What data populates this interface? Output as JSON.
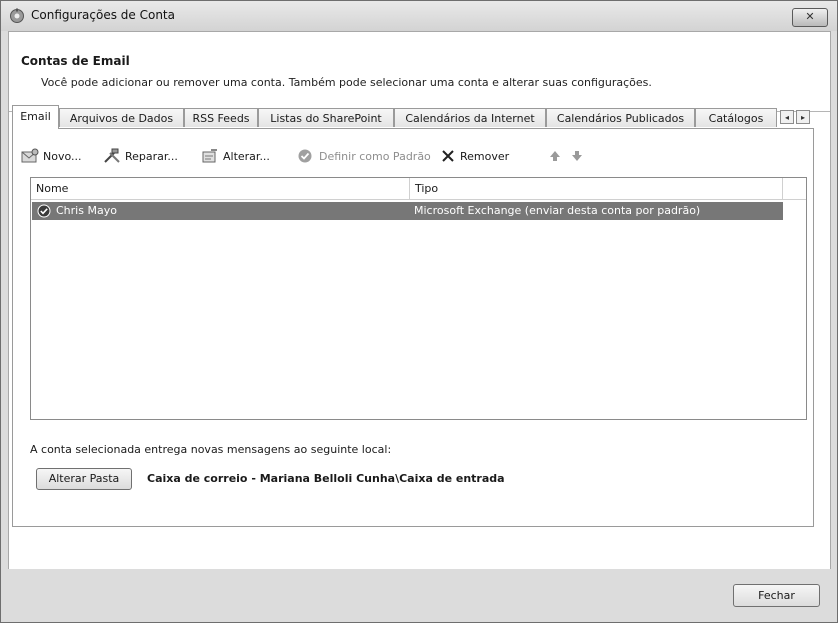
{
  "window": {
    "title": "Configurações de Conta",
    "close_glyph": "✕"
  },
  "header": {
    "title": "Contas de Email",
    "description": "Você pode adicionar ou remover uma conta. Também pode selecionar uma conta e alterar suas configurações."
  },
  "tabs": [
    {
      "label": "Email",
      "active": true
    },
    {
      "label": "Arquivos de Dados",
      "active": false
    },
    {
      "label": "RSS Feeds",
      "active": false
    },
    {
      "label": "Listas do SharePoint",
      "active": false
    },
    {
      "label": "Calendários da Internet",
      "active": false
    },
    {
      "label": "Calendários Publicados",
      "active": false
    },
    {
      "label": "Catálogos",
      "active": false
    }
  ],
  "tab_scroll": {
    "left": "◂",
    "right": "▸"
  },
  "toolbar": {
    "new_label": "Novo...",
    "repair_label": "Reparar...",
    "change_label": "Alterar...",
    "set_default_label": "Definir como Padrão",
    "remove_label": "Remover",
    "move_up_icon": "up-arrow-icon",
    "move_down_icon": "down-arrow-icon"
  },
  "list": {
    "columns": [
      "Nome",
      "Tipo"
    ],
    "rows": [
      {
        "name": "Chris Mayo",
        "type": "Microsoft Exchange (enviar desta conta por padrão)",
        "selected": true
      }
    ]
  },
  "delivery": {
    "label": "A conta selecionada entrega novas mensagens ao seguinte local:",
    "change_folder_button": "Alterar Pasta",
    "location": "Caixa de correio - Mariana Belloli Cunha\\Caixa de entrada"
  },
  "footer": {
    "close_button": "Fechar"
  },
  "colors": {
    "selected_row": "#777777",
    "window_chrome": "#dcdcdc"
  }
}
